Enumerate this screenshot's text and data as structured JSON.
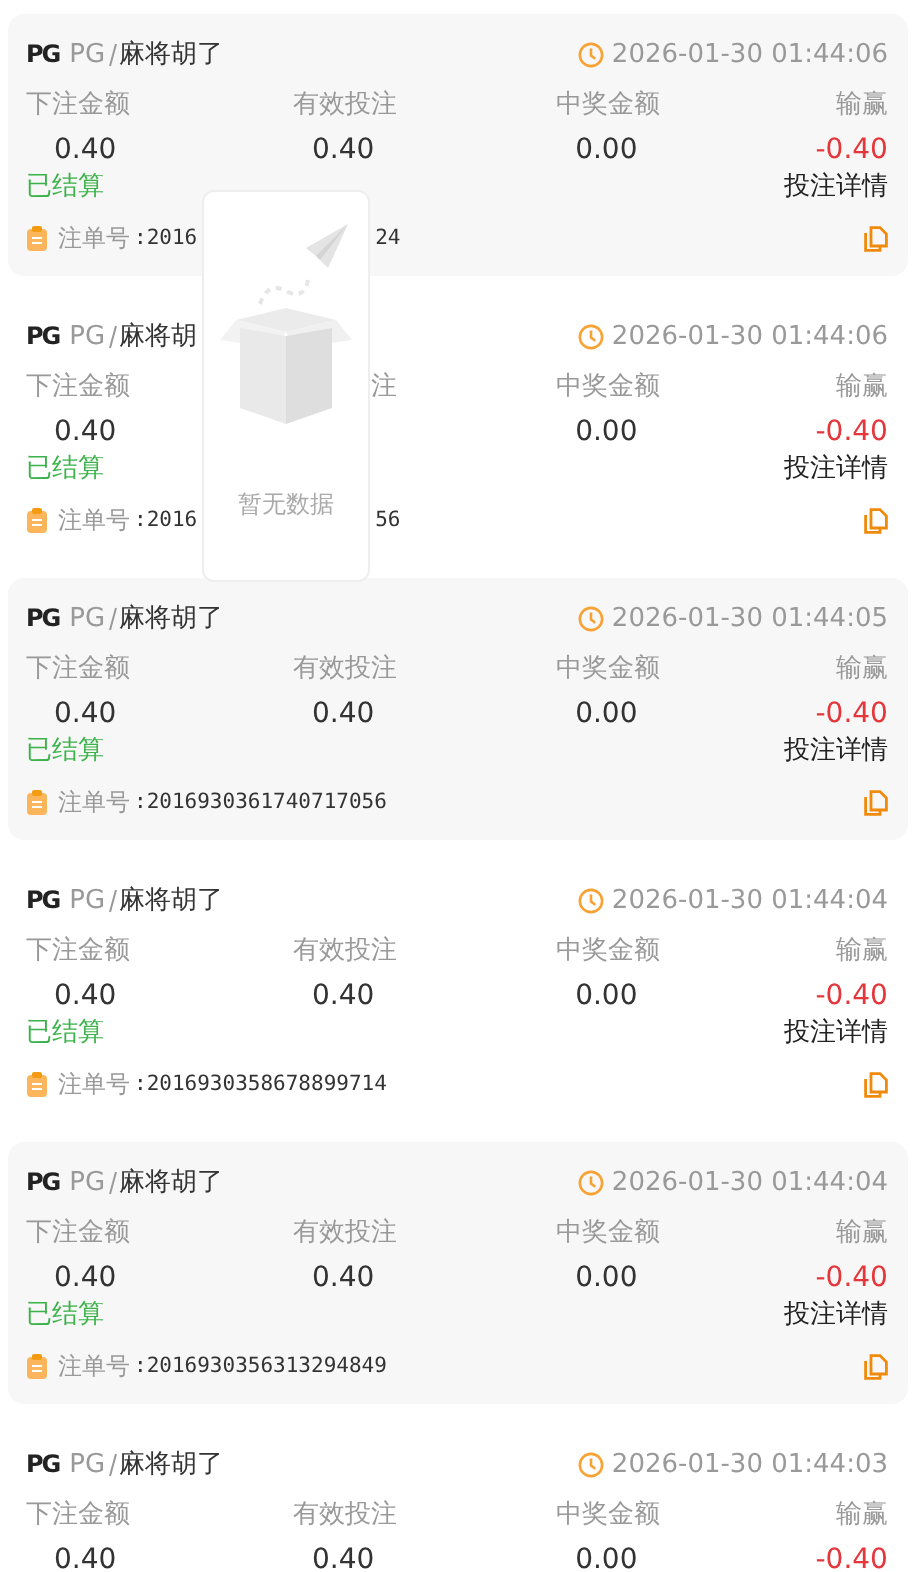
{
  "records": [
    {
      "logo": "PG",
      "provider": "PG",
      "game": "麻将胡了",
      "time": "2026-01-30 01:44:06",
      "stats": [
        {
          "label": "下注金额",
          "value": "0.40"
        },
        {
          "label": "有效投注",
          "value": "0.40"
        },
        {
          "label": "中奖金额",
          "value": "0.00"
        },
        {
          "label": "输赢",
          "value": "-0.40"
        }
      ],
      "status": "已结算",
      "detail": "投注详情",
      "order_label": "注单号",
      "order_no": [
        ":2016",
        "24"
      ]
    },
    {
      "logo": "PG",
      "provider": "PG",
      "game": "麻将胡",
      "time": "2026-01-30 01:44:06",
      "stats": [
        {
          "label": "下注金额",
          "value": "0.40"
        },
        {
          "label": "注"
        },
        {
          "label": "中奖金额",
          "value": "0.00"
        },
        {
          "label": "输赢",
          "value": "-0.40"
        }
      ],
      "status": "已结算",
      "detail": "投注详情",
      "order_label": "注单号",
      "order_no": [
        ":2016",
        "56"
      ]
    },
    {
      "logo": "PG",
      "provider": "PG",
      "game": "麻将胡了",
      "time": "2026-01-30 01:44:05",
      "stats": [
        {
          "label": "下注金额",
          "value": "0.40"
        },
        {
          "label": "有效投注",
          "value": "0.40"
        },
        {
          "label": "中奖金额",
          "value": "0.00"
        },
        {
          "label": "输赢",
          "value": "-0.40"
        }
      ],
      "status": "已结算",
      "detail": "投注详情",
      "order_label": "注单号",
      "order_no": [
        ":2016930361740717056"
      ]
    },
    {
      "logo": "PG",
      "provider": "PG",
      "game": "麻将胡了",
      "time": "2026-01-30 01:44:04",
      "stats": [
        {
          "label": "下注金额",
          "value": "0.40"
        },
        {
          "label": "有效投注",
          "value": "0.40"
        },
        {
          "label": "中奖金额",
          "value": "0.00"
        },
        {
          "label": "输赢",
          "value": "-0.40"
        }
      ],
      "status": "已结算",
      "detail": "投注详情",
      "order_label": "注单号",
      "order_no": [
        ":2016930358678899714"
      ]
    },
    {
      "logo": "PG",
      "provider": "PG",
      "game": "麻将胡了",
      "time": "2026-01-30 01:44:04",
      "stats": [
        {
          "label": "下注金额",
          "value": "0.40"
        },
        {
          "label": "有效投注",
          "value": "0.40"
        },
        {
          "label": "中奖金额",
          "value": "0.00"
        },
        {
          "label": "输赢",
          "value": "-0.40"
        }
      ],
      "status": "已结算",
      "detail": "投注详情",
      "order_label": "注单号",
      "order_no": [
        ":2016930356313294849"
      ]
    },
    {
      "logo": "PG",
      "provider": "PG",
      "game": "麻将胡了",
      "time": "2026-01-30 01:44:03",
      "stats": [
        {
          "label": "下注金额",
          "value": "0.40"
        },
        {
          "label": "有效投注",
          "value": "0.40"
        },
        {
          "label": "中奖金额",
          "value": "0.00"
        },
        {
          "label": "输赢",
          "value": "-0.40"
        }
      ]
    }
  ],
  "empty_state": {
    "text": "暂无数据"
  }
}
